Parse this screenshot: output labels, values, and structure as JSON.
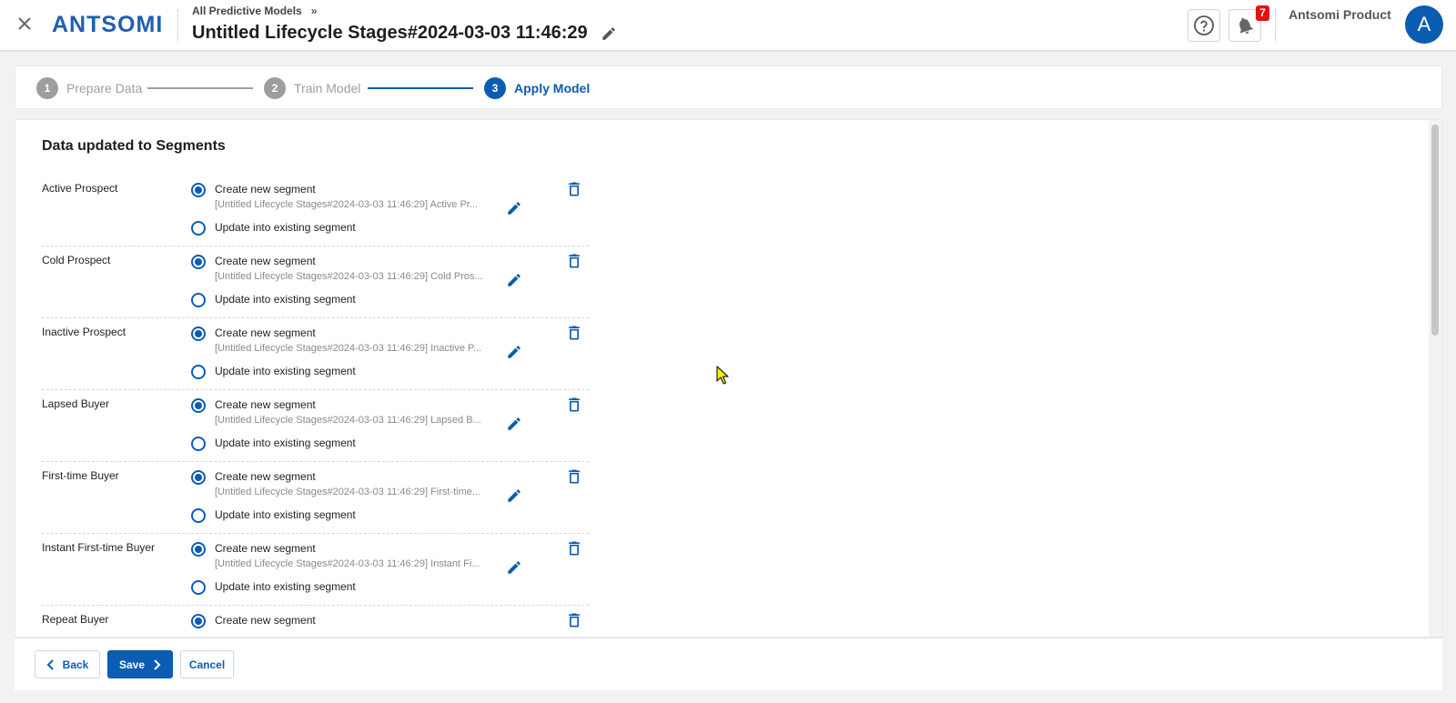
{
  "header": {
    "logo_text": "ANTSOMI",
    "breadcrumb": "All Predictive Models",
    "breadcrumb_chevron": "»",
    "title": "Untitled Lifecycle Stages#2024-03-03 11:46:29",
    "notification_count": "7",
    "user_name": "Antsomi Product",
    "avatar_initial": "A",
    "icons": {
      "close": "close-icon",
      "edit": "pencil-icon",
      "help": "help-circle-icon",
      "bell": "bell-icon"
    }
  },
  "stepper": {
    "steps": [
      {
        "num": "1",
        "label": "Prepare Data",
        "state": "done"
      },
      {
        "num": "2",
        "label": "Train Model",
        "state": "done"
      },
      {
        "num": "3",
        "label": "Apply Model",
        "state": "active"
      }
    ]
  },
  "main": {
    "section_title": "Data updated to Segments",
    "rows": [
      {
        "label": "Active Prospect",
        "option_new": "Create new segment",
        "segment_name": "[Untitled Lifecycle Stages#2024-03-03 11:46:29] Active Pr...",
        "option_existing": "Update into existing segment",
        "selected": "new"
      },
      {
        "label": "Cold Prospect",
        "option_new": "Create new segment",
        "segment_name": "[Untitled Lifecycle Stages#2024-03-03 11:46:29] Cold Pros...",
        "option_existing": "Update into existing segment",
        "selected": "new"
      },
      {
        "label": "Inactive Prospect",
        "option_new": "Create new segment",
        "segment_name": "[Untitled Lifecycle Stages#2024-03-03 11:46:29] Inactive P...",
        "option_existing": "Update into existing segment",
        "selected": "new"
      },
      {
        "label": "Lapsed Buyer",
        "option_new": "Create new segment",
        "segment_name": "[Untitled Lifecycle Stages#2024-03-03 11:46:29] Lapsed B...",
        "option_existing": "Update into existing segment",
        "selected": "new"
      },
      {
        "label": "First-time Buyer",
        "option_new": "Create new segment",
        "segment_name": "[Untitled Lifecycle Stages#2024-03-03 11:46:29] First-time...",
        "option_existing": "Update into existing segment",
        "selected": "new"
      },
      {
        "label": "Instant First-time Buyer",
        "option_new": "Create new segment",
        "segment_name": "[Untitled Lifecycle Stages#2024-03-03 11:46:29] Instant Fi...",
        "option_existing": "Update into existing segment",
        "selected": "new"
      },
      {
        "label": "Repeat Buyer",
        "option_new": "Create new segment",
        "segment_name": "",
        "option_existing": "",
        "selected": "new"
      }
    ]
  },
  "footer": {
    "back_label": "Back",
    "save_label": "Save",
    "cancel_label": "Cancel"
  },
  "colors": {
    "primary": "#0b5cb3",
    "badge": "#e3120b",
    "step_inactive": "#9e9e9e",
    "logo": "#1f5fb0"
  }
}
